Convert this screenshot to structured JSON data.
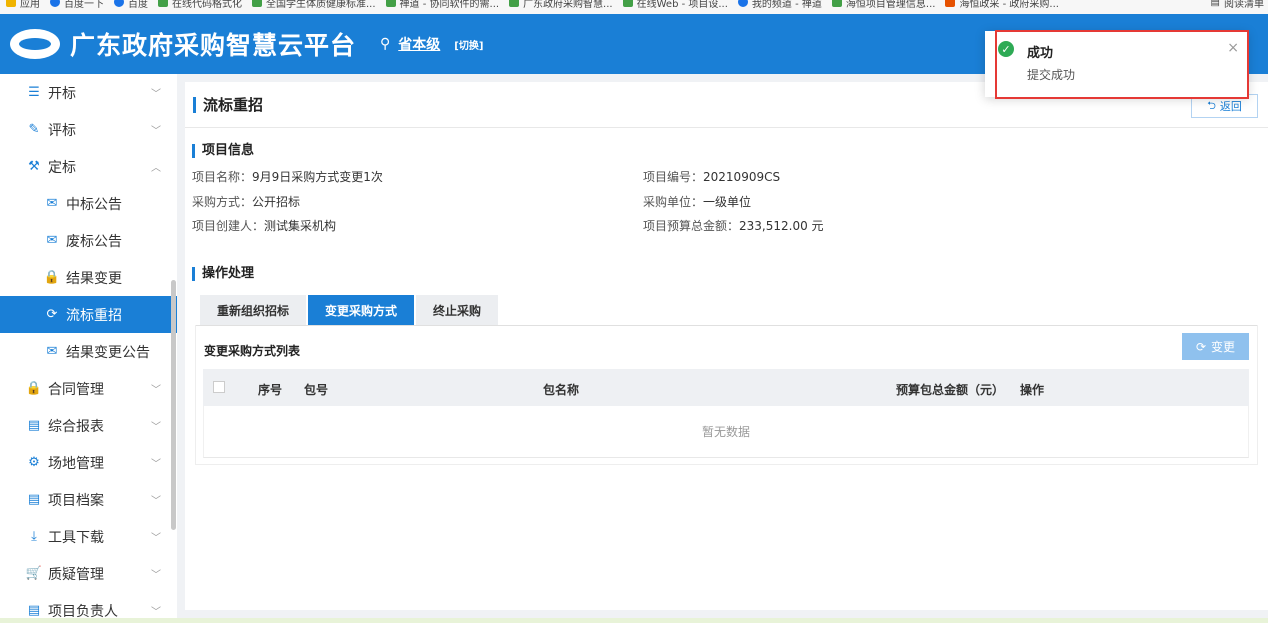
{
  "bookmarks": [
    {
      "label": "应用",
      "icon": "apps-icon"
    },
    {
      "label": "百度一下",
      "icon": "baidu-icon"
    },
    {
      "label": "百度",
      "icon": "globe-icon"
    },
    {
      "label": "在线代码格式化",
      "icon": "globe-icon"
    },
    {
      "label": "全国学生体质健康标准...",
      "icon": "globe-icon"
    },
    {
      "label": "禅道 - 协同软件的需...",
      "icon": "globe-icon"
    },
    {
      "label": "广东政府采购智慧...",
      "icon": "globe-icon"
    },
    {
      "label": "在线Web - 项目设...",
      "icon": "globe-icon"
    },
    {
      "label": "我的频道 - 禅道",
      "icon": "globe-icon"
    },
    {
      "label": "海恒项目管理信息...",
      "icon": "globe-icon"
    },
    {
      "label": "海恒政采 - 政府采购...",
      "icon": "globe-icon"
    }
  ],
  "bookmarks_right": "阅读清单",
  "header": {
    "title": "广东政府采购智慧云平台",
    "region": "省本级",
    "switch": "[切换]"
  },
  "sidebar": {
    "items": [
      {
        "label": "开标",
        "icon": "open-bid-icon",
        "glyph": "☰",
        "expandable": true,
        "chevron": "﹀"
      },
      {
        "label": "评标",
        "icon": "evaluate-icon",
        "glyph": "✎",
        "expandable": true,
        "chevron": "﹀"
      },
      {
        "label": "定标",
        "icon": "gavel-icon",
        "glyph": "⚒",
        "expandable": true,
        "chevron": "︿"
      },
      {
        "label": "中标公告",
        "icon": "mail-icon",
        "glyph": "✉",
        "sub": true
      },
      {
        "label": "废标公告",
        "icon": "mail-icon",
        "glyph": "✉",
        "sub": true
      },
      {
        "label": "结果变更",
        "icon": "lock-icon",
        "glyph": "🔒",
        "sub": true
      },
      {
        "label": "流标重招",
        "icon": "refresh-icon",
        "glyph": "⟳",
        "sub": true,
        "active": true
      },
      {
        "label": "结果变更公告",
        "icon": "mail-icon",
        "glyph": "✉",
        "sub": true
      },
      {
        "label": "合同管理",
        "icon": "lock-icon",
        "glyph": "🔒",
        "expandable": true,
        "chevron": "﹀"
      },
      {
        "label": "综合报表",
        "icon": "report-icon",
        "glyph": "▤",
        "expandable": true,
        "chevron": "﹀"
      },
      {
        "label": "场地管理",
        "icon": "user-gear-icon",
        "glyph": "⚙",
        "expandable": true,
        "chevron": "﹀"
      },
      {
        "label": "项目档案",
        "icon": "archive-icon",
        "glyph": "▤",
        "expandable": true,
        "chevron": "﹀"
      },
      {
        "label": "工具下载",
        "icon": "download-icon",
        "glyph": "⤓",
        "expandable": true,
        "chevron": "﹀"
      },
      {
        "label": "质疑管理",
        "icon": "cart-icon",
        "glyph": "🛒",
        "expandable": true,
        "chevron": "﹀"
      },
      {
        "label": "项目负责人",
        "icon": "person-doc-icon",
        "glyph": "▤",
        "expandable": true,
        "chevron": "﹀"
      }
    ]
  },
  "page": {
    "title": "流标重招",
    "back_label": "返回"
  },
  "project_info": {
    "title": "项目信息",
    "fields": {
      "name_label": "项目名称：",
      "name_value": "9月9日采购方式变更1次",
      "code_label": "项目编号：",
      "code_value": "20210909CS",
      "method_label": "采购方式：",
      "method_value": "公开招标",
      "unit_label": "采购单位：",
      "unit_value": "一级单位",
      "creator_label": "项目创建人：",
      "creator_value": "测试集采机构",
      "budget_label": "项目预算总金额：",
      "budget_value": "233,512.00 元"
    }
  },
  "operations": {
    "title": "操作处理",
    "tabs": [
      "重新组织招标",
      "变更采购方式",
      "终止采购"
    ],
    "active_tab": 1,
    "list_title": "变更采购方式列表",
    "change_label": "变更",
    "columns": [
      "序号",
      "包号",
      "包名称",
      "预算包总金额（元）",
      "操作"
    ],
    "empty_text": "暂无数据"
  },
  "toast": {
    "title": "成功",
    "message": "提交成功",
    "close": "×"
  },
  "colors": {
    "primary": "#1a7fd6",
    "success": "#2eaa55",
    "highlight": "#e53935"
  }
}
